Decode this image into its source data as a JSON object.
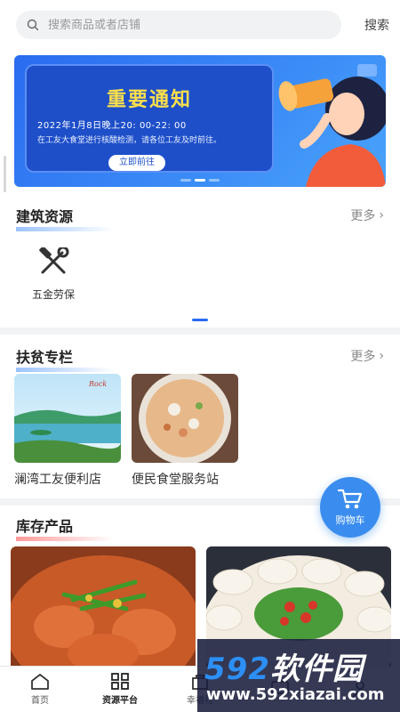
{
  "search": {
    "placeholder": "搜索商品或者店铺",
    "button": "搜索"
  },
  "banner": {
    "title": "重要通知",
    "line1": "2022年1月8日晚上20: 00-22: 00",
    "line2": "在工友大食堂进行核酸检测，请各位工友及时前往。",
    "button": "立即前往"
  },
  "building": {
    "title": "建筑资源",
    "more": "更多",
    "items": [
      {
        "label": "五金劳保",
        "icon": "wrench-hammer-icon"
      }
    ]
  },
  "poverty": {
    "title": "扶贫专栏",
    "more": "更多",
    "cards": [
      {
        "title": "澜湾工友便利店"
      },
      {
        "title": "便民食堂服务站"
      }
    ]
  },
  "stock": {
    "title": "库存产品"
  },
  "cart": {
    "label": "购物车"
  },
  "tabbar": [
    {
      "label": "首页",
      "icon": "home-icon"
    },
    {
      "label": "资源平台",
      "icon": "grid-icon",
      "active": true
    },
    {
      "label": "幸福社",
      "icon": "bag-icon"
    },
    {
      "label": "",
      "icon": "message-icon"
    },
    {
      "label": "",
      "icon": "user-icon"
    }
  ],
  "watermark": {
    "big_prefix": "592",
    "big_suffix": "软件园",
    "url": "www.592xiazai.com"
  },
  "colors": {
    "accent": "#2a6bf0",
    "cart": "#3a8dee",
    "banner_title": "#ffe04a"
  }
}
